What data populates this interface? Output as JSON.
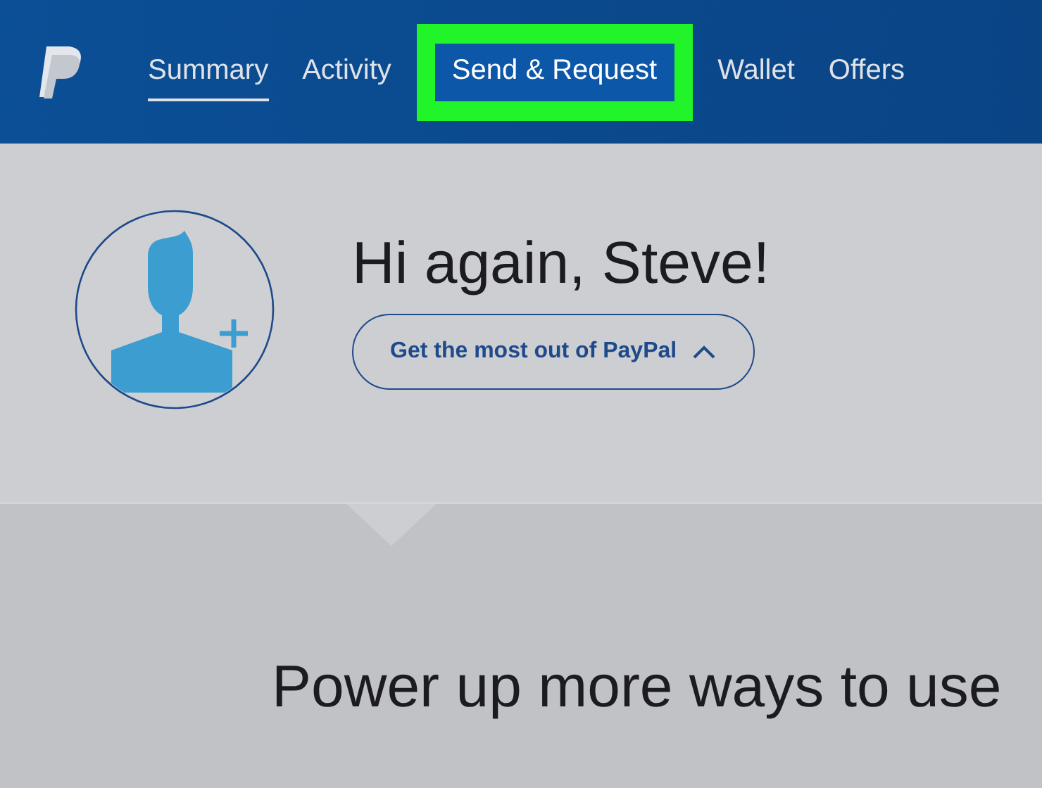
{
  "nav": {
    "tabs": [
      {
        "label": "Summary",
        "selected": true,
        "highlighted": false
      },
      {
        "label": "Activity",
        "selected": false,
        "highlighted": false
      },
      {
        "label": "Send & Request",
        "selected": false,
        "highlighted": true
      },
      {
        "label": "Wallet",
        "selected": false,
        "highlighted": false
      },
      {
        "label": "Offers",
        "selected": false,
        "highlighted": false
      }
    ]
  },
  "greeting": {
    "title": "Hi again, Steve!",
    "button": "Get the most out of PayPal"
  },
  "promo": {
    "heading": "Power up more ways to use"
  }
}
